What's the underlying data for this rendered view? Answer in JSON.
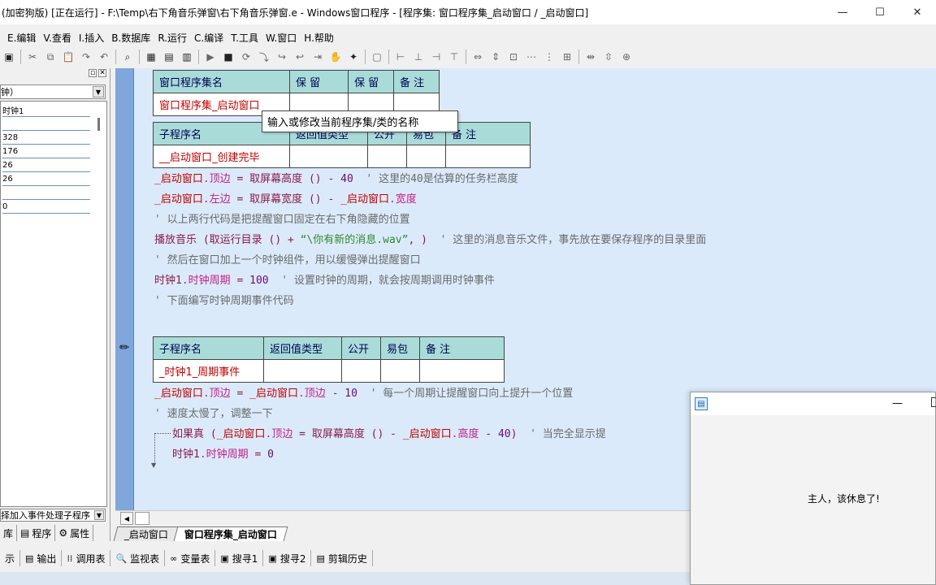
{
  "window": {
    "title": "(加密狗版) [正在运行] - F:\\Temp\\右下角音乐弹窗\\右下角音乐弹窗.e - Windows窗口程序 - [程序集: 窗口程序集_启动窗口 / _启动窗口]",
    "minimize": "—",
    "maximize": "☐",
    "close": "✕"
  },
  "menu": [
    "E.编辑",
    "V.查看",
    "I.插入",
    "B.数据库",
    "R.运行",
    "C.编译",
    "T.工具",
    "W.窗口",
    "H.帮助"
  ],
  "left_panel": {
    "combo": "钟）",
    "rows": [
      "时钟1",
      "",
      "328",
      "176",
      "26",
      "26",
      "",
      "0"
    ],
    "bottom_combo": "择加入事件处理子程序",
    "tabs": [
      "库",
      "程序",
      "属性"
    ]
  },
  "editor": {
    "assembly_table": {
      "headers": [
        "窗口程序集名",
        "保 留",
        "保 留",
        "备 注"
      ],
      "values": [
        "窗口程序集_启动窗口",
        "",
        "",
        ""
      ]
    },
    "sub1_table": {
      "headers": [
        "子程序名",
        "返回值类型",
        "公开",
        "易包",
        "备 注"
      ],
      "values": [
        "__启动窗口_创建完毕",
        "",
        "",
        "",
        ""
      ]
    },
    "code1": [
      {
        "a": "_启动窗口",
        "b": ".顶边",
        "c": " = ",
        "d": "取屏幕高度",
        "e": " () - ",
        "f": "40",
        "g": "  ' 这里的40是估算的任务栏高度"
      },
      {
        "a": "_启动窗口",
        "b": ".左边",
        "c": " = ",
        "d": "取屏幕宽度",
        "e": " () - ",
        "f": "_启动窗口",
        "g": ".宽度"
      },
      {
        "text": "' 以上两行代码是把提醒窗口固定在右下角隐藏的位置"
      },
      {
        "a": "播放音乐",
        "b": " (",
        "c": "取运行目录",
        "d": " () + ",
        "e": "“\\你有新的消息.wav”",
        "f": ", )",
        "g": "  ' 这里的消息音乐文件，事先放在要保存程序的目录里面"
      },
      {
        "text": "' 然后在窗口加上一个时钟组件，用以缓慢弹出提醒窗口"
      },
      {
        "a": "时钟1",
        "b": ".时钟周期",
        "c": " = ",
        "d": "100",
        "e": "  ' 设置时钟的周期，就会按周期调用时钟事件"
      },
      {
        "text": "' 下面编写时钟周期事件代码"
      }
    ],
    "sub2_table": {
      "headers": [
        "子程序名",
        "返回值类型",
        "公开",
        "易包",
        "备 注"
      ],
      "values": [
        "_时钟1_周期事件",
        "",
        "",
        "",
        ""
      ]
    },
    "code2": [
      {
        "a": "_启动窗口",
        "b": ".顶边",
        "c": " = ",
        "d": "_启动窗口",
        "e": ".顶边",
        "f": " - ",
        "g": "10",
        "h": "  ' 每一个周期让提醒窗口向上提升一个位置"
      },
      {
        "text": "' 速度太慢了，调整一下"
      },
      {
        "a": "如果真",
        "b": " (",
        "c": "_启动窗口",
        "d": ".顶边",
        "e": " = ",
        "f": "取屏幕高度",
        "g": " () - ",
        "h": "_启动窗口",
        "i": ".高度",
        "j": " - ",
        "k": "40",
        "l": ")",
        "m": "  ' 当完全显示提"
      },
      {
        "a": "时钟1",
        "b": ".时钟周期",
        "c": " = ",
        "d": "0"
      }
    ],
    "tooltip": "输入或修改当前程序集/类的名称"
  },
  "doc_tabs": [
    "_启动窗口",
    "窗口程序集_启动窗口"
  ],
  "bottom_tools": [
    {
      "icon": "示",
      "label": ""
    },
    {
      "icon": "▤",
      "label": "输出"
    },
    {
      "icon": "⁞⁞",
      "label": "调用表"
    },
    {
      "icon": "🔍",
      "label": "监视表"
    },
    {
      "icon": "∞",
      "label": "变量表"
    },
    {
      "icon": "▣",
      "label": "搜寻1"
    },
    {
      "icon": "▣",
      "label": "搜寻2"
    },
    {
      "icon": "▤",
      "label": "剪辑历史"
    }
  ],
  "popup": {
    "message": "主人，该休息了!",
    "minimize": "—"
  }
}
